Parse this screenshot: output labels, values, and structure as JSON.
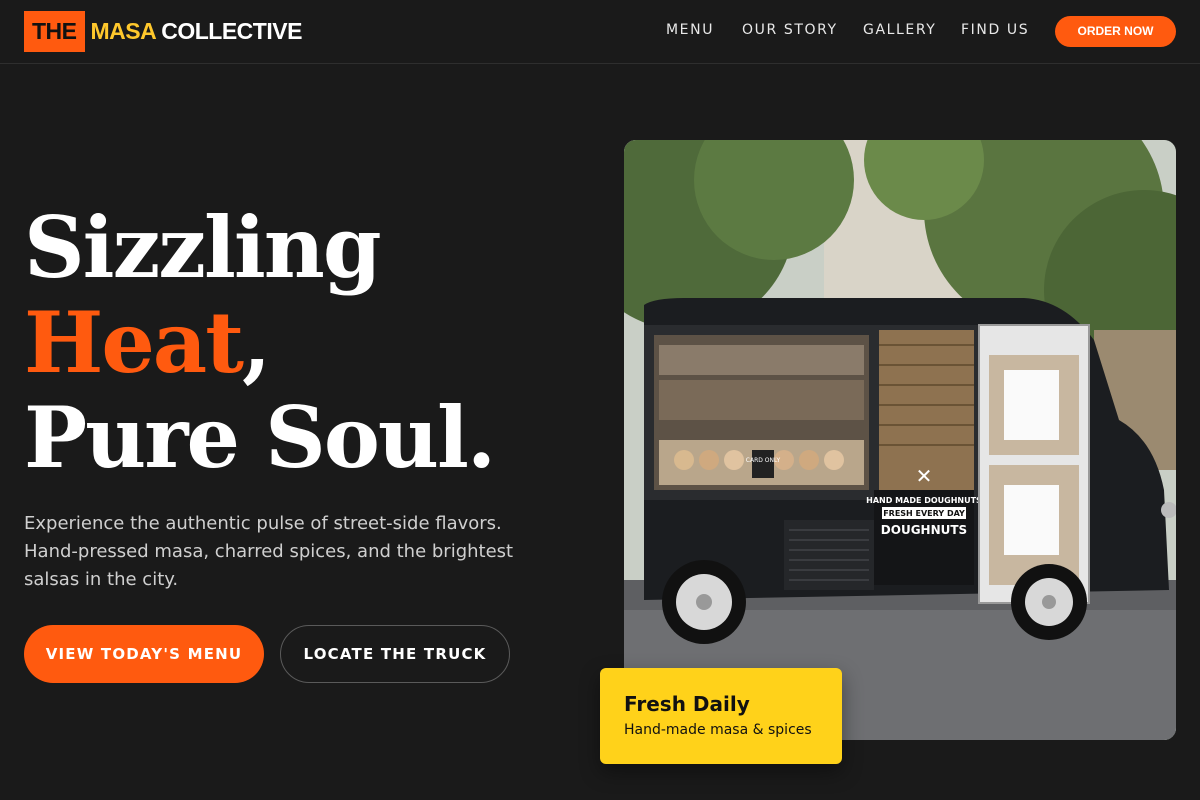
{
  "brand": {
    "logo_box": "THE",
    "logo_mid": "MASA",
    "logo_end": "COLLECTIVE",
    "accent_color": "#ff5a0f",
    "secondary_color": "#ffc82c"
  },
  "nav": {
    "items": [
      {
        "label": "MENU"
      },
      {
        "label": "OUR STORY"
      },
      {
        "label": "GALLERY"
      },
      {
        "label": "FIND US"
      }
    ],
    "cta_label": "ORDER NOW"
  },
  "hero": {
    "line1": "Sizzling",
    "line2_accent": "Heat",
    "line2_rest": ",",
    "line3": "Pure Soul.",
    "description": "Experience the authentic pulse of street-side flavors. Hand-pressed masa, charred spices, and the brightest salsas in the city.",
    "primary_button": "VIEW TODAY'S MENU",
    "secondary_button": "LOCATE THE TRUCK"
  },
  "image": {
    "sign_line1": "HAND MADE DOUGHNUTS",
    "sign_line2": "FRESH EVERY DAY",
    "sign_line3": "DOUGHNUTS",
    "card_sign": "CARD ONLY",
    "icon": "food-truck-photo"
  },
  "badge": {
    "title": "Fresh Daily",
    "subtitle": "Hand-made masa & spices"
  }
}
